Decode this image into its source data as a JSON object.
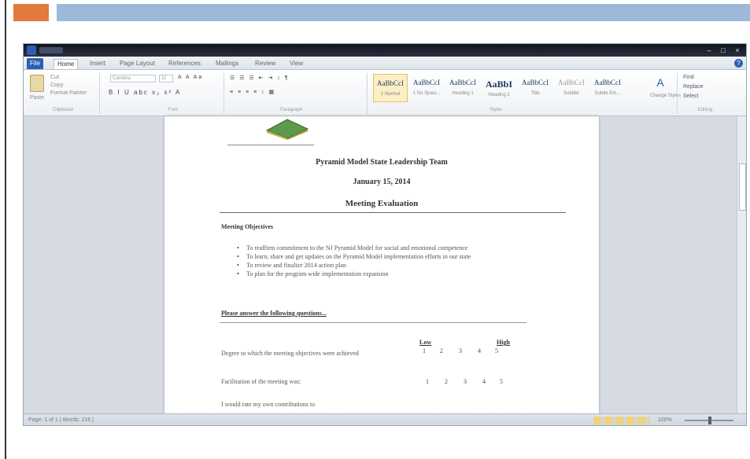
{
  "slide": {
    "colors": {
      "accent_orange": "#e07a3d",
      "accent_blue": "#9db9d9"
    }
  },
  "word": {
    "title": "",
    "tabs": [
      "File",
      "Home",
      "Insert",
      "Page Layout",
      "References",
      "Mailings",
      "Review",
      "View"
    ],
    "active_tab": "Home",
    "ribbon": {
      "clipboard": {
        "paste_label": "Paste",
        "cut_label": "Cut",
        "copy_label": "Copy",
        "format_painter_label": "Format Painter",
        "group_label": "Clipboard"
      },
      "font": {
        "font_name": "Cambria",
        "font_size": "11",
        "group_label": "Font"
      },
      "paragraph": {
        "group_label": "Paragraph"
      },
      "styles": {
        "items": [
          {
            "sample": "AaBbCcI",
            "name": "1 Normal"
          },
          {
            "sample": "AaBbCcI",
            "name": "1 No Spaci..."
          },
          {
            "sample": "AaBbCcI",
            "name": "Heading 1"
          },
          {
            "sample": "AaBbI",
            "name": "Heading 2"
          },
          {
            "sample": "AaBbCcI",
            "name": "Title"
          },
          {
            "sample": "AaBbCcI",
            "name": "Subtitle"
          },
          {
            "sample": "AaBbCcI",
            "name": "Subtle Em..."
          }
        ],
        "change_styles_label": "Change Styles",
        "group_label": "Styles"
      },
      "editing": {
        "find_label": "Find",
        "replace_label": "Replace",
        "select_label": "Select",
        "group_label": "Editing"
      }
    },
    "document": {
      "title": "Pyramid Model State Leadership Team",
      "date": "January 15, 2014",
      "subtitle": "Meeting Evaluation",
      "objectives_heading": "Meeting Objectives",
      "objectives": [
        "To reaffirm commitment to the NJ Pyramid Model for social and emotional competence",
        "To learn, share and get updates on the Pyramid Model implementation efforts in our state",
        "To review and finalize 2014 action plan",
        "To plan for the program wide implementation expansion"
      ],
      "questions_heading": "Please answer the following questions...",
      "scale_low": "Low",
      "scale_high": "High",
      "scale": [
        "1",
        "2",
        "3",
        "4",
        "5"
      ],
      "questions": [
        "Degree to which the meeting objectives were achieved",
        "Facilitation of the meeting was:",
        "I would rate my own contributions to"
      ]
    },
    "status": {
      "left_text": "Page: 1 of 1   |   Words: 216   |",
      "zoom": "100%"
    }
  }
}
